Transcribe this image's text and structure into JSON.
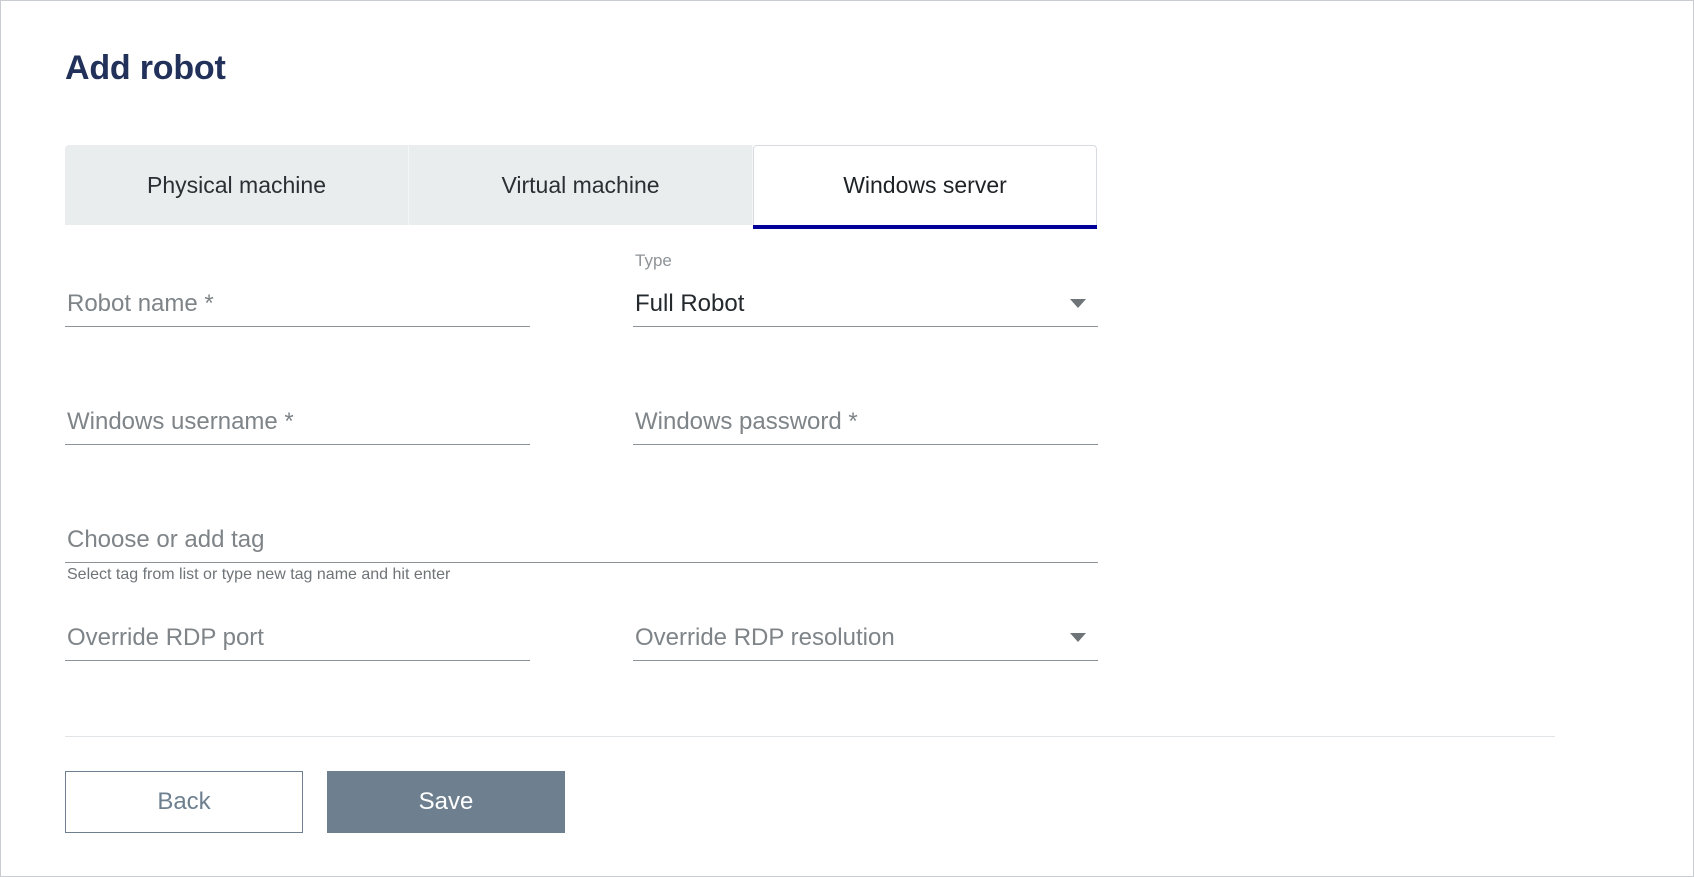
{
  "page": {
    "title": "Add robot"
  },
  "tabs": [
    {
      "id": "physical-machine",
      "label": "Physical machine",
      "active": false
    },
    {
      "id": "virtual-machine",
      "label": "Virtual machine",
      "active": false
    },
    {
      "id": "windows-server",
      "label": "Windows server",
      "active": true
    }
  ],
  "form": {
    "robot_name": {
      "placeholder": "Robot name *",
      "value": ""
    },
    "type": {
      "label": "Type",
      "value": "Full Robot",
      "options": [
        "Full Robot"
      ],
      "caret": "chevron-down-icon"
    },
    "windows_username": {
      "placeholder": "Windows username *",
      "value": ""
    },
    "windows_password": {
      "placeholder": "Windows password *",
      "value": ""
    },
    "tag": {
      "placeholder": "Choose or add tag",
      "value": "",
      "hint": "Select tag from list or type new tag name and hit enter"
    },
    "override_rdp_port": {
      "placeholder": "Override RDP port",
      "value": ""
    },
    "override_rdp_resolution": {
      "placeholder": "Override RDP resolution",
      "value": "",
      "caret": "chevron-down-icon"
    }
  },
  "actions": {
    "back_label": "Back",
    "save_label": "Save"
  },
  "colors": {
    "title": "#22315a",
    "tab_inactive_bg": "#e9edee",
    "tab_active_underline": "#000099",
    "placeholder_text": "#7e8488",
    "field_underline": "#8d9296",
    "save_button_bg": "#6e8090",
    "back_button_border": "#6e8090"
  }
}
